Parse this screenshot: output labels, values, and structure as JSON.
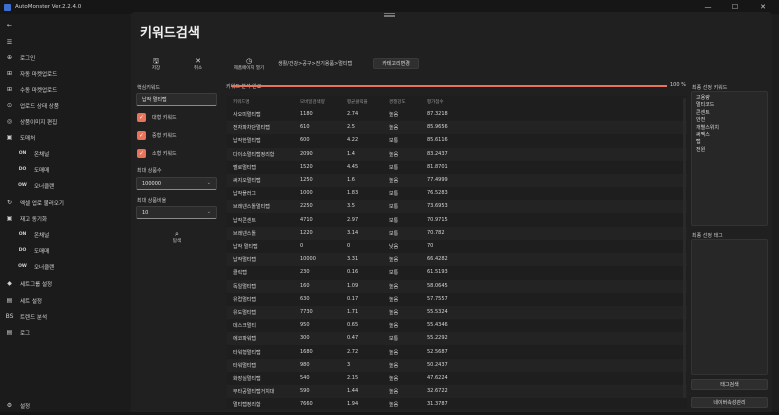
{
  "window": {
    "title": "AutoMonster Ver.2.2.4.0",
    "minimize": "—",
    "maximize": "☐",
    "close": "✕"
  },
  "sidebar": {
    "items": [
      {
        "icon": "←",
        "label": ""
      },
      {
        "icon": "☰",
        "label": ""
      },
      {
        "icon": "⊕",
        "label": "로그인"
      },
      {
        "icon": "⊞",
        "label": "자동 마켓업로드"
      },
      {
        "icon": "⊞",
        "label": "수동 마켓업로드"
      },
      {
        "icon": "⊙",
        "label": "업로드 상태 상품"
      },
      {
        "icon": "◎",
        "label": "상품이미지 편집"
      },
      {
        "icon": "▣",
        "label": "도매처"
      },
      {
        "icon": "ON",
        "label": "온채널"
      },
      {
        "icon": "DO",
        "label": "도매매"
      },
      {
        "icon": "OW",
        "label": "오너클랜"
      },
      {
        "icon": "↻",
        "label": "엑셀 업로 불러오기"
      },
      {
        "icon": "▣",
        "label": "재고 동기화"
      },
      {
        "icon": "ON",
        "label": "온채널"
      },
      {
        "icon": "DO",
        "label": "도매매"
      },
      {
        "icon": "OW",
        "label": "오너클랜"
      },
      {
        "icon": "◆",
        "label": "세트그룹 설정"
      },
      {
        "icon": "▤",
        "label": "세트 설정"
      },
      {
        "icon": "BS",
        "label": "트렌드 분석"
      },
      {
        "icon": "▤",
        "label": "로그"
      }
    ],
    "settings": {
      "icon": "⚙",
      "label": "설정"
    }
  },
  "page": {
    "title": "키워드검색"
  },
  "toolbar": {
    "save": {
      "icon": "🖫",
      "label": "저장"
    },
    "delete": {
      "icon": "✕",
      "label": "취소"
    },
    "open_product": {
      "icon": "◷",
      "label": "제품페이지 열기"
    }
  },
  "breadcrumb": "생활/건강>공구>전기용품>멀티탭",
  "category_change_button": "카테고리변경",
  "left_form": {
    "core_keyword_label": "핵심키워드",
    "core_keyword_value": "납작 멀티탭",
    "checkboxes": [
      {
        "label": "대형 키워드",
        "checked": true
      },
      {
        "label": "중형 키워드",
        "checked": true
      },
      {
        "label": "소형 키워드",
        "checked": true
      }
    ],
    "max_products_label": "최대 상품수",
    "max_products_value": "100000",
    "max_ratio_label": "최대 상품비율",
    "max_ratio_value": "10",
    "search_icon": "⌕",
    "search_label": "탐색"
  },
  "progress": {
    "label": "키워드 분석 완료",
    "percent_text": "100 %",
    "value": 1.0,
    "color": "#e8735a"
  },
  "table": {
    "headers": [
      "키워드명",
      "모바일검색량",
      "평균클릭율",
      "경쟁강도",
      "평가점수"
    ],
    "rows": [
      [
        "사오미멀티탭",
        "1180",
        "2.74",
        "높음",
        "87.3218"
      ],
      [
        "전자파차단멀티탭",
        "610",
        "2.5",
        "높음",
        "85.9656"
      ],
      [
        "납작한멀티탭",
        "600",
        "4.22",
        "보통",
        "85.6116"
      ],
      [
        "다이소멀티탭정리함",
        "2090",
        "1.4",
        "높음",
        "83.2437"
      ],
      [
        "벨로멀티탭",
        "1520",
        "4.45",
        "보통",
        "81.8701"
      ],
      [
        "써지오멀티탭",
        "1250",
        "1.6",
        "높음",
        "77.4999"
      ],
      [
        "납작플러그",
        "1000",
        "1.83",
        "보통",
        "76.5283"
      ],
      [
        "브레넨스톨멀티탭",
        "2250",
        "3.5",
        "보통",
        "73.6953"
      ],
      [
        "납작콘센트",
        "4710",
        "2.97",
        "보통",
        "70.9715"
      ],
      [
        "브레넨스톨",
        "1220",
        "3.14",
        "보통",
        "70.782"
      ],
      [
        "납작 멀티탭",
        "0",
        "0",
        "낮음",
        "70"
      ],
      [
        "납작멀티탭",
        "10000",
        "3.31",
        "높음",
        "66.4282"
      ],
      [
        "클릭탭",
        "230",
        "0.16",
        "보통",
        "61.5193"
      ],
      [
        "독일멀티탭",
        "160",
        "1.09",
        "높음",
        "58.0645"
      ],
      [
        "유럽멀티탭",
        "630",
        "0.17",
        "높음",
        "57.7557"
      ],
      [
        "유도멀티탭",
        "7730",
        "1.71",
        "높음",
        "55.5324"
      ],
      [
        "데스크멀티",
        "950",
        "0.65",
        "높음",
        "55.4346"
      ],
      [
        "에코파워탭",
        "300",
        "0.47",
        "보통",
        "55.2292"
      ],
      [
        "타워형멀티탭",
        "1680",
        "2.72",
        "높음",
        "52.5687"
      ],
      [
        "타워멀티탭",
        "980",
        "3",
        "높음",
        "50.2437"
      ],
      [
        "화장실멀티탭",
        "540",
        "2.15",
        "높음",
        "47.6224"
      ],
      [
        "무타공멀티탭거치대",
        "590",
        "1.44",
        "높음",
        "32.6722"
      ],
      [
        "멀티탭정리함",
        "7660",
        "1.94",
        "높음",
        "31.3787"
      ]
    ]
  },
  "right_panel": {
    "final_keywords_label": "최종 선정 키워드",
    "final_keywords": [
      "고용량",
      "멀티코드",
      "콘센트",
      "안전",
      "개별스위치",
      "써멕스",
      "탭",
      "전원"
    ],
    "final_tags_label": "최종 선정 태그",
    "tag_search_button": "태그검색",
    "naver_attr_button": "네이버속성관리"
  }
}
